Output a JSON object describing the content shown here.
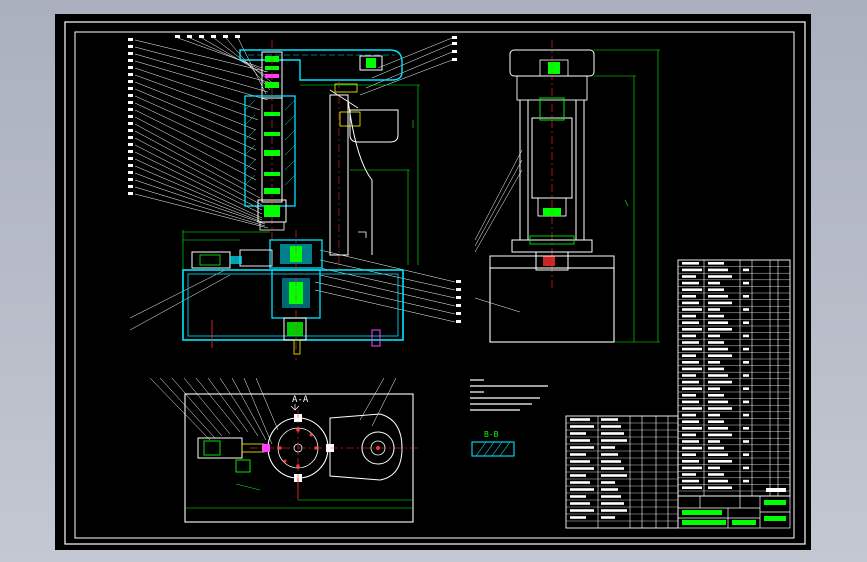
{
  "drawing": {
    "section_aa_label": "A-A",
    "section_bb_label": "B-B"
  },
  "colors": {
    "background": "#000000",
    "frame": "#ffffff",
    "part_outline": "#ffffff",
    "section_cyan": "#00e5ff",
    "hatch_green": "#00ff00",
    "dimension_green": "#00ff00",
    "center_red": "#ff3030",
    "accent_magenta": "#ff40ff",
    "accent_yellow": "#ffff00"
  }
}
